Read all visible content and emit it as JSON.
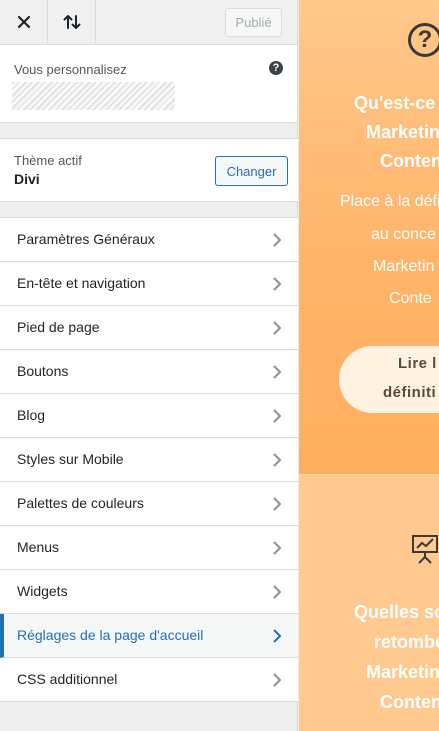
{
  "toolbar": {
    "close_icon": "close-icon",
    "reorder_icon": "reorder-arrows-icon",
    "publish_label": "Publié"
  },
  "customizing": {
    "label": "Vous personnalisez",
    "help_icon": "help-icon"
  },
  "theme": {
    "label": "Thème actif",
    "name": "Divi",
    "change_label": "Changer"
  },
  "menu": {
    "items": [
      {
        "label": "Paramètres Généraux"
      },
      {
        "label": "En-tête et navigation"
      },
      {
        "label": "Pied de page"
      },
      {
        "label": "Boutons"
      },
      {
        "label": "Blog"
      },
      {
        "label": "Styles sur Mobile"
      },
      {
        "label": "Palettes de couleurs"
      },
      {
        "label": "Menus"
      },
      {
        "label": "Widgets"
      },
      {
        "label": "Réglages de la page d'accueil",
        "active": true
      },
      {
        "label": "CSS additionnel"
      }
    ]
  },
  "preview": {
    "section1": {
      "icon": "question-circle-icon",
      "headline": [
        "Qu'est-ce",
        "Marketin",
        "Conten"
      ],
      "body": [
        "Place à la défi",
        "au conce",
        "Marketin",
        "Conte"
      ],
      "button": [
        "Lire l",
        "définiti"
      ]
    },
    "section2": {
      "icon": "presentation-board-icon",
      "headline": [
        "Quelles so",
        "retombé",
        "Marketin",
        "Conten"
      ]
    }
  },
  "colors": {
    "accent": "#2271b1",
    "preview_orange": "#ffb469",
    "preview_light": "#ffc990"
  }
}
